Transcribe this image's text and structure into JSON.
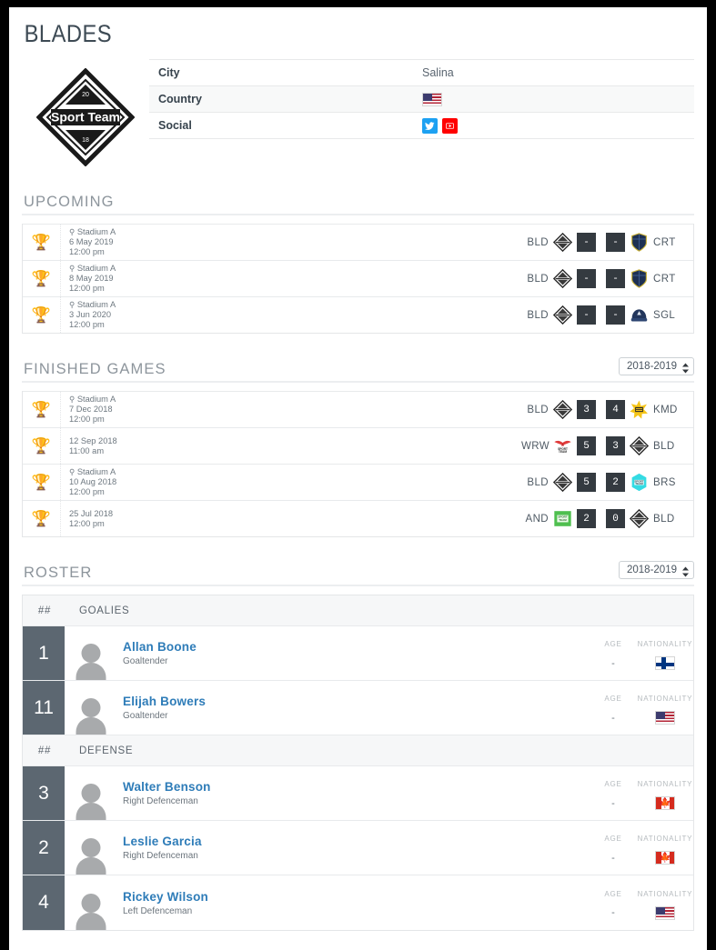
{
  "page": {
    "title": "BLADES",
    "logo": {
      "name": "sport-team-diamond-logo",
      "text": "Sport Team",
      "top_number": "20",
      "bottom_number": "18"
    }
  },
  "info_table": {
    "rows": [
      {
        "label": "City",
        "value": "Salina",
        "type": "text"
      },
      {
        "label": "Country",
        "value": "",
        "type": "flag-us"
      },
      {
        "label": "Social",
        "value": "",
        "type": "social"
      }
    ],
    "social": [
      {
        "name": "twitter-icon",
        "glyph": "🐦",
        "color": "#1da1f2"
      },
      {
        "name": "youtube-icon",
        "glyph": "▶",
        "color": "#ff0000"
      }
    ]
  },
  "upcoming": {
    "heading": "UPCOMING",
    "games": [
      {
        "venue": "Stadium A",
        "date": "6 May 2019",
        "time": "12:00 pm",
        "home": "BLD",
        "away": "CRT",
        "home_score": "-",
        "away_score": "-",
        "home_crest": "bld",
        "away_crest": "crt"
      },
      {
        "venue": "Stadium A",
        "date": "8 May 2019",
        "time": "12:00 pm",
        "home": "BLD",
        "away": "CRT",
        "home_score": "-",
        "away_score": "-",
        "home_crest": "bld",
        "away_crest": "crt"
      },
      {
        "venue": "Stadium A",
        "date": "3 Jun 2020",
        "time": "12:00 pm",
        "home": "BLD",
        "away": "SGL",
        "home_score": "-",
        "away_score": "-",
        "home_crest": "bld",
        "away_crest": "sgl"
      }
    ]
  },
  "finished": {
    "heading": "FINISHED GAMES",
    "season": "2018-2019",
    "season_options": [
      "2018-2019"
    ],
    "games": [
      {
        "venue": "Stadium A",
        "date": "7 Dec 2018",
        "time": "12:00 pm",
        "home": "BLD",
        "away": "KMD",
        "home_score": "3",
        "away_score": "4",
        "home_crest": "bld",
        "away_crest": "kmd"
      },
      {
        "venue": "",
        "date": "12 Sep 2018",
        "time": "11:00 am",
        "home": "WRW",
        "away": "BLD",
        "home_score": "5",
        "away_score": "3",
        "home_crest": "wrw",
        "away_crest": "bld"
      },
      {
        "venue": "Stadium A",
        "date": "10 Aug 2018",
        "time": "12:00 pm",
        "home": "BLD",
        "away": "BRS",
        "home_score": "5",
        "away_score": "2",
        "home_crest": "bld",
        "away_crest": "brs"
      },
      {
        "venue": "",
        "date": "25 Jul 2018",
        "time": "12:00 pm",
        "home": "AND",
        "away": "BLD",
        "home_score": "2",
        "away_score": "0",
        "home_crest": "and",
        "away_crest": "bld"
      }
    ]
  },
  "roster": {
    "heading": "ROSTER",
    "season": "2018-2019",
    "season_options": [
      "2018-2019"
    ],
    "number_column_header": "##",
    "stat_headers": {
      "age": "AGE",
      "nationality": "NATIONALITY"
    },
    "groups": [
      {
        "name": "GOALIES",
        "players": [
          {
            "number": "1",
            "name": "Allan Boone",
            "position": "Goaltender",
            "age": "-",
            "nationality": "fi"
          },
          {
            "number": "11",
            "name": "Elijah Bowers",
            "position": "Goaltender",
            "age": "-",
            "nationality": "us"
          }
        ]
      },
      {
        "name": "DEFENSE",
        "players": [
          {
            "number": "3",
            "name": "Walter Benson",
            "position": "Right Defenceman",
            "age": "-",
            "nationality": "ca"
          },
          {
            "number": "2",
            "name": "Leslie Garcia",
            "position": "Right Defenceman",
            "age": "-",
            "nationality": "ca"
          },
          {
            "number": "4",
            "name": "Rickey Wilson",
            "position": "Left Defenceman",
            "age": "-",
            "nationality": "us"
          }
        ]
      }
    ]
  },
  "colors": {
    "title": "#3d4a54",
    "section_title": "#8d959c",
    "score_box": "#343a40",
    "number_badge": "#5c6771",
    "player_link": "#2e7cb8",
    "trophy": "#f2c53d",
    "twitter": "#1da1f2",
    "youtube": "#ff0000"
  }
}
